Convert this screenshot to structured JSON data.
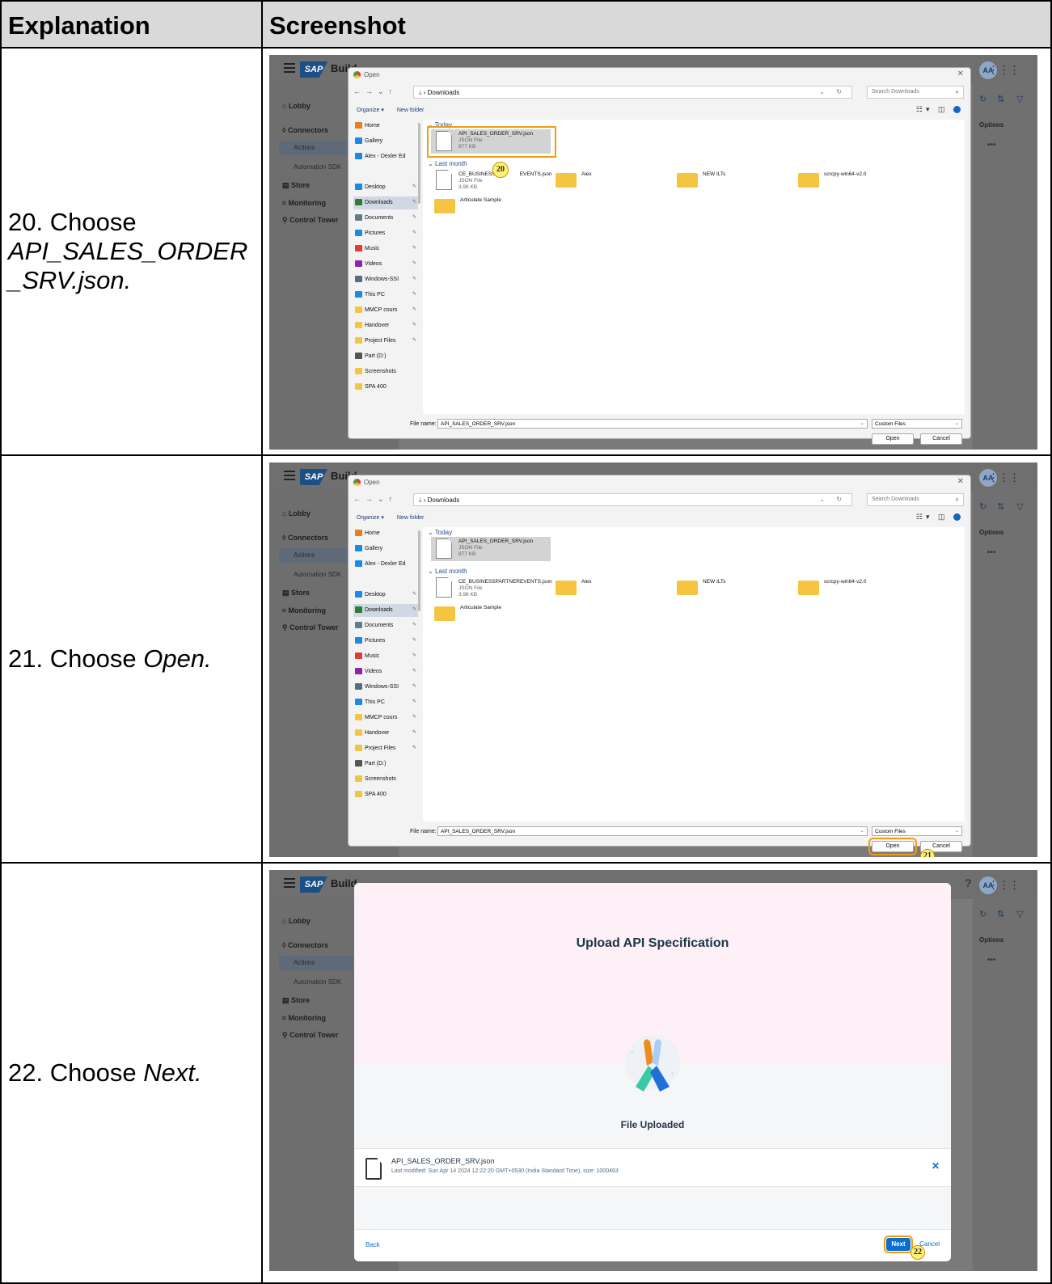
{
  "table": {
    "col_explanation": "Explanation",
    "col_screenshot": "Screenshot"
  },
  "steps": [
    {
      "num": "20.",
      "verb": "Choose",
      "target_line1": "API_SALES_ORDER",
      "target_line2": "_SRV.json."
    },
    {
      "num": "21.",
      "verb": "Choose",
      "target": "Open."
    },
    {
      "num": "22.",
      "verb": "Choose",
      "target": "Next."
    }
  ],
  "app_shell": {
    "logo": "SAP",
    "product": "Build",
    "avatar": "AA",
    "nav": {
      "lobby": "Lobby",
      "connectors": "Connectors",
      "actions": "Actions",
      "automation_sdk": "Automation SDK",
      "store": "Store",
      "monitoring": "Monitoring",
      "control_tower": "Control Tower"
    },
    "options_header": "Options",
    "options_menu": "•••"
  },
  "open_dialog": {
    "title": "Open",
    "path": "Downloads",
    "search_placeholder": "Search Downloads",
    "organize": "Organize ▾",
    "new_folder": "New folder",
    "tree": [
      {
        "label": "Home",
        "color": "#e67e22",
        "pinned": false
      },
      {
        "label": "Gallery",
        "color": "#1e88e5",
        "pinned": false
      },
      {
        "label": "Alex - Dexler Ed",
        "color": "#1e88e5",
        "pinned": false
      },
      {
        "label": "Desktop",
        "color": "#1e88e5",
        "pinned": true
      },
      {
        "label": "Downloads",
        "color": "#2e7d32",
        "pinned": true,
        "selected": true
      },
      {
        "label": "Documents",
        "color": "#607d8b",
        "pinned": true
      },
      {
        "label": "Pictures",
        "color": "#1e88e5",
        "pinned": true
      },
      {
        "label": "Music",
        "color": "#e53935",
        "pinned": true
      },
      {
        "label": "Videos",
        "color": "#8e24aa",
        "pinned": true
      },
      {
        "label": "Windows-SSI",
        "color": "#546e7a",
        "pinned": true
      },
      {
        "label": "This PC",
        "color": "#1e88e5",
        "pinned": true
      },
      {
        "label": "MMCP cours",
        "color": "#f5c542",
        "pinned": true
      },
      {
        "label": "Handover",
        "color": "#f5c542",
        "pinned": true
      },
      {
        "label": "Project Files",
        "color": "#f5c542",
        "pinned": true
      },
      {
        "label": "Part (D:)",
        "color": "#555555",
        "pinned": false
      },
      {
        "label": "Screenshots",
        "color": "#f5c542",
        "pinned": false
      },
      {
        "label": "SPA 400",
        "color": "#f5c542",
        "pinned": false
      }
    ],
    "group_today": "Today",
    "group_last_month": "Last month",
    "file_selected": {
      "name": "API_SALES_ORDER_SRV.json",
      "type": "JSON File",
      "size": "977 KB"
    },
    "file_2": {
      "name_a": "CE_BUSINESSPA",
      "name_b": "EVENTS.json",
      "name_full": "CE_BUSINESSPARTNEREVENTS.json",
      "type": "JSON File",
      "size": "3.98 KB"
    },
    "folders": [
      "Alex",
      "NEW ILTs",
      "scrcpy-win64-v2.0",
      "Articulate Sample"
    ],
    "file_name_label": "File name:",
    "file_name_value": "API_SALES_ORDER_SRV.json",
    "file_type": "Custom Files",
    "open_btn": "Open",
    "cancel_btn": "Cancel"
  },
  "callouts": {
    "c20": "20",
    "c21": "21",
    "c22": "22"
  },
  "upload_dialog": {
    "title": "Upload API Specification",
    "status": "File Uploaded",
    "file_name": "API_SALES_ORDER_SRV.json",
    "file_meta": "Last modified: Sun Apr 14 2024 12:22:20 GMT+0530 (India Standard Time), size: 1000463",
    "back": "Back",
    "next": "Next",
    "cancel": "Cancel"
  },
  "colors": {
    "highlight": "#f39c12",
    "callout_fill": "#fff176",
    "sap_blue": "#0a6ed1"
  }
}
